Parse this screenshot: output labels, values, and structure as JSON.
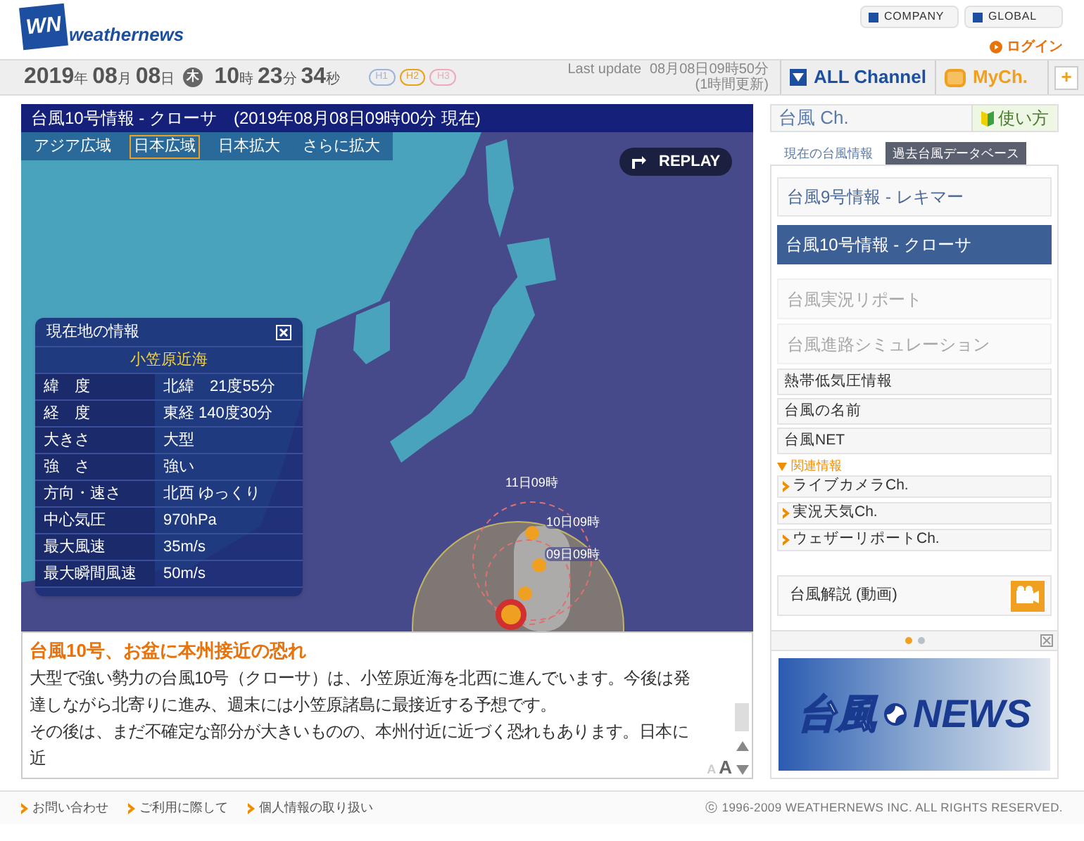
{
  "header": {
    "logo_mark": "WN",
    "logo_text": "weathernews",
    "links": [
      "COMPANY",
      "GLOBAL"
    ],
    "login": "ログイン"
  },
  "datebar": {
    "date_parts": [
      {
        "value": "2019",
        "unit": "年"
      },
      {
        "value": "08",
        "unit": "月"
      },
      {
        "value": "08",
        "unit": "日"
      }
    ],
    "weekday": "木",
    "time_parts": [
      {
        "value": "10",
        "unit": "時"
      },
      {
        "value": "23",
        "unit": "分"
      },
      {
        "value": "34",
        "unit": "秒"
      }
    ],
    "levels": [
      {
        "label": "H1",
        "color": "#9fb4dc"
      },
      {
        "label": "H2",
        "color": "#e8a21c"
      },
      {
        "label": "H3",
        "color": "#eeaabb"
      }
    ],
    "last_update_label": "Last update",
    "last_update": "08月08日09時50分",
    "update_note": "(1時間更新)",
    "channel_menu": "ALL Channel",
    "mych": "MyCh.",
    "add": "+"
  },
  "map": {
    "title": "台風10号情報 - クローサ　(2019年08月08日09時00分 現在)",
    "tabs": [
      {
        "label": "アジア広域",
        "selected": false
      },
      {
        "label": "日本広域",
        "selected": true
      },
      {
        "label": "日本拡大",
        "selected": false
      },
      {
        "label": "さらに拡大",
        "selected": false
      }
    ],
    "replay": "REPLAY",
    "track_labels": [
      "11日09時",
      "10日09時",
      "09日09時"
    ],
    "info_panel": {
      "title": "現在地の情報",
      "area": "小笠原近海",
      "rows": [
        {
          "label": "緯　度",
          "value": "北緯　21度55分"
        },
        {
          "label": "経　度",
          "value": "東経 140度30分"
        },
        {
          "label": "大きさ",
          "value": "大型"
        },
        {
          "label": "強　さ",
          "value": "強い"
        },
        {
          "label": "方向・速さ",
          "value": "北西 ゆっくり"
        },
        {
          "label": "中心気圧",
          "value": "970hPa"
        },
        {
          "label": "最大風速",
          "value": "35m/s"
        },
        {
          "label": "最大瞬間風速",
          "value": "50m/s"
        }
      ]
    }
  },
  "article": {
    "headline": "台風10号、お盆に本州接近の恐れ",
    "paragraphs": [
      "大型で強い勢力の台風10号（クローサ）は、小笠原近海を北西に進んでいます。今後は発達しながら北寄りに進み、週末には小笠原諸島に最接近する予想です。",
      "その後は、まだ不確定な部分が大きいものの、本州付近に近づく恐れもあります。日本に近"
    ],
    "font_sizes": [
      "A",
      "A"
    ]
  },
  "sidebar": {
    "title": "台風 Ch.",
    "help": "使い方",
    "tabs": [
      {
        "label": "現在の台風情報",
        "selected": true
      },
      {
        "label": "過去台風データベース",
        "selected": false
      }
    ],
    "typhoons": [
      {
        "label": "台風9号情報 - レキマー",
        "selected": false
      },
      {
        "label": "台風10号情報 - クローサ",
        "selected": true
      }
    ],
    "tools": [
      {
        "label": "台風実況リポート",
        "disabled": true
      },
      {
        "label": "台風進路シミュレーション",
        "disabled": true
      }
    ],
    "links": [
      "熱帯低気圧情報",
      "台風の名前",
      "台風NET"
    ],
    "related": {
      "title": "関連情報",
      "expanded": true,
      "links": [
        "ライブカメラCh.",
        "実況天気Ch.",
        "ウェザーリポートCh."
      ]
    },
    "video": "台風解説 (動画)",
    "carousel_dots": [
      {
        "selected": true
      },
      {
        "selected": false
      }
    ],
    "banner": {
      "text_jp": "台風",
      "text_en": "NEWS"
    }
  },
  "footer": {
    "links": [
      "お問い合わせ",
      "ご利用に際して",
      "個人情報の取り扱い"
    ],
    "copyright": "ⓒ 1996-2009 WEATHERNEWS INC. ALL RIGHTS RESERVED."
  }
}
